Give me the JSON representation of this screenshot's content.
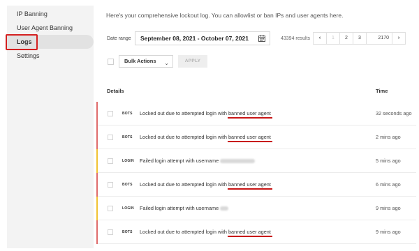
{
  "sidebar": {
    "items": [
      {
        "label": "IP Banning"
      },
      {
        "label": "User Agent Banning"
      },
      {
        "label": "Logs"
      },
      {
        "label": "Settings"
      }
    ]
  },
  "main": {
    "intro": "Here's your comprehensive lockout log. You can allowlist or ban IPs and user agents here."
  },
  "filters": {
    "date_label": "Date range",
    "date_value": "September 08, 2021 - October 07, 2021",
    "results": "43394 results",
    "pagination": [
      "‹",
      "1",
      "2",
      "3",
      "2170",
      "›"
    ]
  },
  "bulk": {
    "select_label": "Bulk Actions",
    "apply_label": "APPLY"
  },
  "table": {
    "col_details": "Details",
    "col_time": "Time",
    "rows": [
      {
        "tag": "BOTS",
        "msg_prefix": "Locked out due to attempted login with",
        "msg_highlight": "banned user agent",
        "time": "32 seconds ago",
        "color": "#e06b6b"
      },
      {
        "tag": "BOTS",
        "msg_prefix": "Locked out due to attempted login with",
        "msg_highlight": "banned user agent",
        "time": "2 mins ago",
        "color": "#e06b6b"
      },
      {
        "tag": "LOGIN",
        "msg_prefix": "Failed login attempt with username",
        "msg_highlight": "",
        "time": "5 mins ago",
        "color": "#f1c232"
      },
      {
        "tag": "BOTS",
        "msg_prefix": "Locked out due to attempted login with",
        "msg_highlight": "banned user agent",
        "time": "6 mins ago",
        "color": "#e06b6b"
      },
      {
        "tag": "LOGIN",
        "msg_prefix": "Failed login attempt with username",
        "msg_highlight": "",
        "time": "9 mins ago",
        "color": "#f1c232"
      },
      {
        "tag": "BOTS",
        "msg_prefix": "Locked out due to attempted login with",
        "msg_highlight": "banned user agent",
        "time": "9 mins ago",
        "color": "#e06b6b"
      }
    ]
  },
  "colors": {
    "highlight_red": "#d42020",
    "bots_edge": "#e06b6b",
    "login_edge": "#f1c232"
  }
}
